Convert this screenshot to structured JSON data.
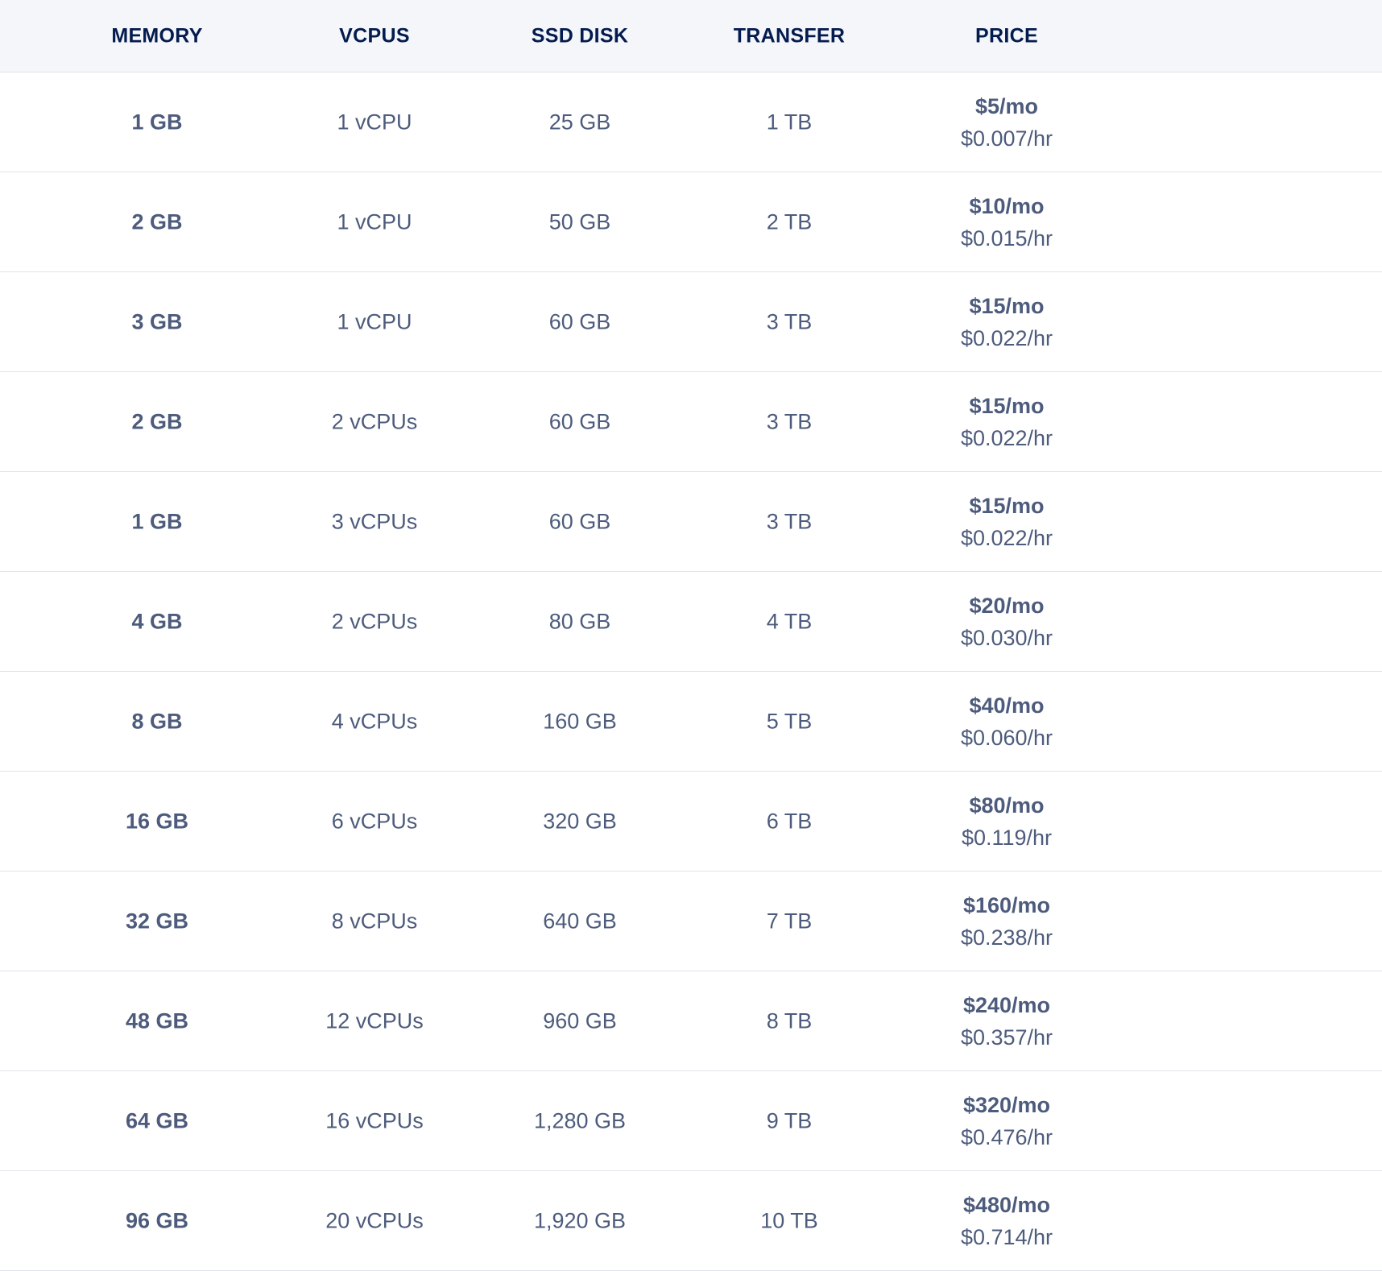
{
  "table": {
    "headers": {
      "memory": "MEMORY",
      "vcpus": "VCPUS",
      "disk": "SSD DISK",
      "transfer": "TRANSFER",
      "price": "PRICE"
    },
    "rows": [
      {
        "memory": "1 GB",
        "vcpus": "1 vCPU",
        "disk": "25 GB",
        "transfer": "1 TB",
        "price_mo": "$5/mo",
        "price_hr": "$0.007/hr"
      },
      {
        "memory": "2 GB",
        "vcpus": "1 vCPU",
        "disk": "50 GB",
        "transfer": "2 TB",
        "price_mo": "$10/mo",
        "price_hr": "$0.015/hr"
      },
      {
        "memory": "3 GB",
        "vcpus": "1 vCPU",
        "disk": "60 GB",
        "transfer": "3 TB",
        "price_mo": "$15/mo",
        "price_hr": "$0.022/hr"
      },
      {
        "memory": "2 GB",
        "vcpus": "2 vCPUs",
        "disk": "60 GB",
        "transfer": "3 TB",
        "price_mo": "$15/mo",
        "price_hr": "$0.022/hr"
      },
      {
        "memory": "1 GB",
        "vcpus": "3 vCPUs",
        "disk": "60 GB",
        "transfer": "3 TB",
        "price_mo": "$15/mo",
        "price_hr": "$0.022/hr"
      },
      {
        "memory": "4 GB",
        "vcpus": "2 vCPUs",
        "disk": "80 GB",
        "transfer": "4 TB",
        "price_mo": "$20/mo",
        "price_hr": "$0.030/hr"
      },
      {
        "memory": "8 GB",
        "vcpus": "4 vCPUs",
        "disk": "160 GB",
        "transfer": "5 TB",
        "price_mo": "$40/mo",
        "price_hr": "$0.060/hr"
      },
      {
        "memory": "16 GB",
        "vcpus": "6 vCPUs",
        "disk": "320 GB",
        "transfer": "6 TB",
        "price_mo": "$80/mo",
        "price_hr": "$0.119/hr"
      },
      {
        "memory": "32 GB",
        "vcpus": "8 vCPUs",
        "disk": "640 GB",
        "transfer": "7 TB",
        "price_mo": "$160/mo",
        "price_hr": "$0.238/hr"
      },
      {
        "memory": "48 GB",
        "vcpus": "12 vCPUs",
        "disk": "960 GB",
        "transfer": "8 TB",
        "price_mo": "$240/mo",
        "price_hr": "$0.357/hr"
      },
      {
        "memory": "64 GB",
        "vcpus": "16 vCPUs",
        "disk": "1,280 GB",
        "transfer": "9 TB",
        "price_mo": "$320/mo",
        "price_hr": "$0.476/hr"
      },
      {
        "memory": "96 GB",
        "vcpus": "20 vCPUs",
        "disk": "1,920 GB",
        "transfer": "10 TB",
        "price_mo": "$480/mo",
        "price_hr": "$0.714/hr"
      }
    ]
  },
  "colors": {
    "header_background": "#f4f6fa",
    "header_text": "#031b4e",
    "body_text": "#4d5b7c",
    "row_divider": "#dfe3ea"
  }
}
